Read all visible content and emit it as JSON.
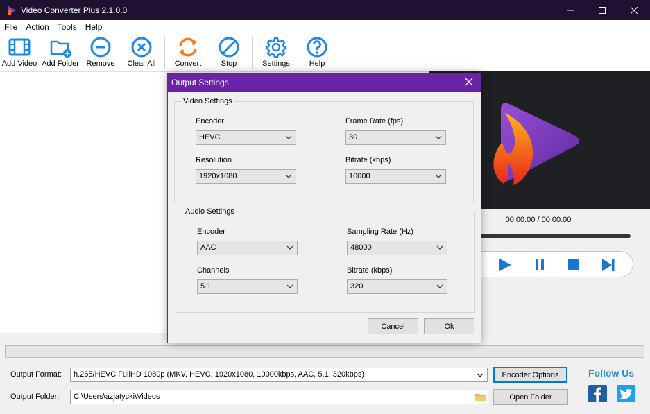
{
  "window": {
    "title": "Video Converter Plus 2.1.0.0",
    "controls": {
      "minimize": "—",
      "maximize": "☐",
      "close": "✕"
    }
  },
  "menu": [
    "File",
    "Action",
    "Tools",
    "Help"
  ],
  "toolbar": {
    "add_video": "Add Video",
    "add_folder": "Add Folder",
    "remove": "Remove",
    "clear_all": "Clear All",
    "convert": "Convert",
    "stop": "Stop",
    "settings": "Settings",
    "help": "Help"
  },
  "player": {
    "timecode": "00:00:00 / 00:00:00"
  },
  "output": {
    "format_label": "Output Format:",
    "format_value": "h.265/HEVC FullHD 1080p (MKV, HEVC, 1920x1080, 10000kbps, AAC, 5.1, 320kbps)",
    "folder_label": "Output Folder:",
    "folder_value": "C:\\Users\\azjatycki\\Videos",
    "encoder_options": "Encoder Options",
    "open_folder": "Open Folder"
  },
  "social": {
    "follow_us": "Follow Us"
  },
  "dialog": {
    "title": "Output Settings",
    "video_group": "Video Settings",
    "video": {
      "encoder_label": "Encoder",
      "encoder_value": "HEVC",
      "frame_rate_label": "Frame Rate (fps)",
      "frame_rate_value": "30",
      "resolution_label": "Resolution",
      "resolution_value": "1920x1080",
      "bitrate_label": "Bitrate (kbps)",
      "bitrate_value": "10000"
    },
    "audio_group": "Audio Settings",
    "audio": {
      "encoder_label": "Encoder",
      "encoder_value": "AAC",
      "sampling_label": "Sampling Rate (Hz)",
      "sampling_value": "48000",
      "channels_label": "Channels",
      "channels_value": "5.1",
      "bitrate_label": "Bitrate (kbps)",
      "bitrate_value": "320"
    },
    "cancel": "Cancel",
    "ok": "Ok"
  },
  "colors": {
    "titlebar": "#1f1130",
    "dialog_title": "#6a22a7",
    "toolbar_blue": "#1e88e5",
    "convert_orange": "#f57c1f",
    "player_blue": "#1976d2",
    "facebook": "#1e5fa5",
    "twitter": "#1da1f2"
  }
}
